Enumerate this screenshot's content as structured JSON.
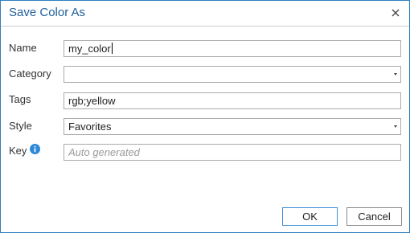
{
  "dialog": {
    "title": "Save Color As",
    "close_icon": "close-icon"
  },
  "form": {
    "name": {
      "label": "Name",
      "value": "my_color"
    },
    "category": {
      "label": "Category",
      "value": ""
    },
    "tags": {
      "label": "Tags",
      "value": "rgb;yellow"
    },
    "style": {
      "label": "Style",
      "value": "Favorites"
    },
    "key": {
      "label": "Key",
      "value": "",
      "placeholder": "Auto generated",
      "icon": "info-icon"
    }
  },
  "buttons": {
    "ok": "OK",
    "cancel": "Cancel"
  },
  "colors": {
    "accent": "#2f7fc1",
    "title": "#1f5f9b"
  }
}
